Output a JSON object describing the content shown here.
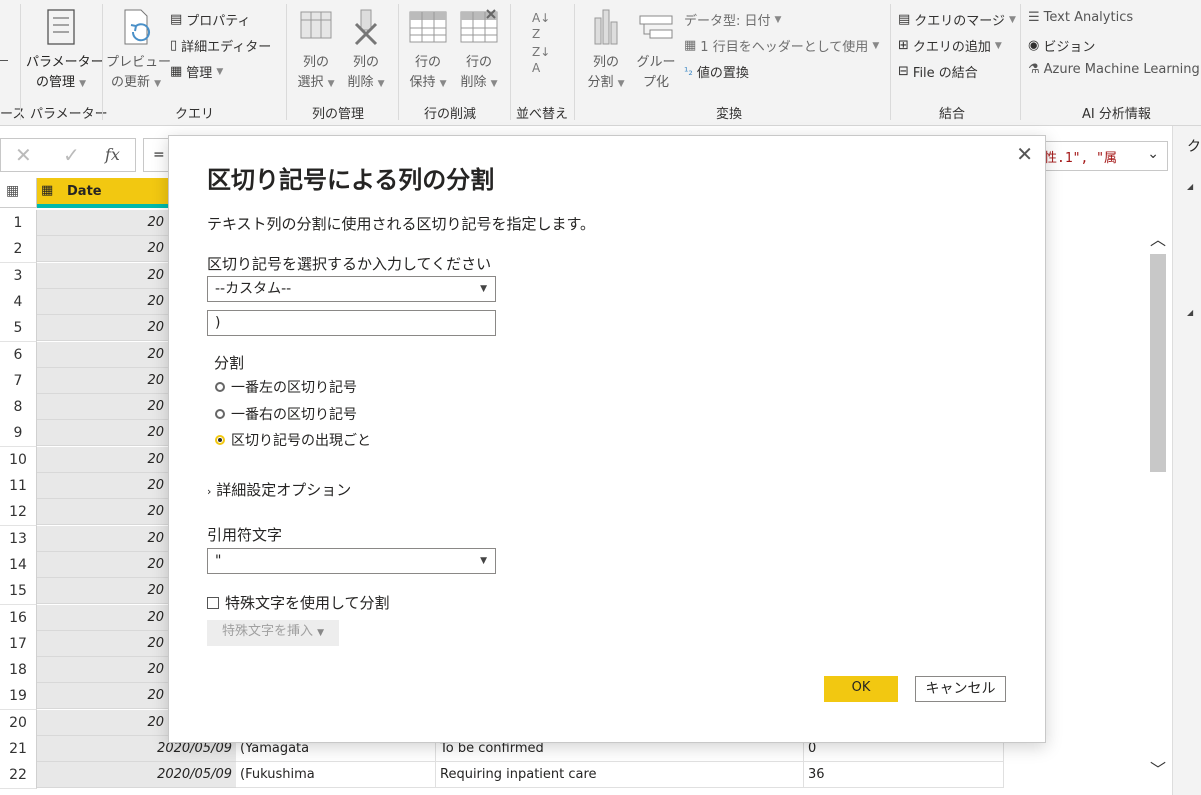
{
  "ribbon": {
    "groups": [
      {
        "label": "ース"
      },
      {
        "label": "パラメーター"
      },
      {
        "label": "クエリ"
      },
      {
        "label": "列の管理"
      },
      {
        "label": "行の削減"
      },
      {
        "label": "並べ替え"
      },
      {
        "label": "変換"
      },
      {
        "label": "結合"
      },
      {
        "label": "AI 分析情報"
      }
    ],
    "param_manage": {
      "line1": "パラメーター",
      "line2": "の管理"
    },
    "preview_refresh": {
      "line1": "プレビュー",
      "line2": "の更新"
    },
    "properties": "プロパティ",
    "advanced_editor": "詳細エディター",
    "manage": "管理",
    "choose_columns": {
      "line1": "列の",
      "line2": "選択"
    },
    "remove_columns": {
      "line1": "列の",
      "line2": "削除"
    },
    "keep_rows": {
      "line1": "行の",
      "line2": "保持"
    },
    "remove_rows": {
      "line1": "行の",
      "line2": "削除"
    },
    "split_column": {
      "line1": "列の",
      "line2": "分割"
    },
    "group_by": {
      "line1": "グルー",
      "line2": "プ化"
    },
    "data_type": "データ型: 日付",
    "use_first_row": "1 行目をヘッダーとして使用",
    "replace_values": "値の置換",
    "merge_queries": "クエリのマージ",
    "append_queries": "クエリの追加",
    "combine_files": "File の結合",
    "text_analytics": "Text Analytics",
    "vision": "ビジョン",
    "azure_ml": "Azure Machine Learning"
  },
  "formula_bar": {
    "fx": "fx",
    "equals": "=",
    "right_text": "性.1\", \"属"
  },
  "grid": {
    "header_date": "Date",
    "row_numbers": [
      "1",
      "2",
      "3",
      "4",
      "5",
      "6",
      "7",
      "8",
      "9",
      "10",
      "11",
      "12",
      "13",
      "14",
      "15",
      "16",
      "17",
      "18",
      "19",
      "20",
      "21",
      "22"
    ],
    "date_partial": "20",
    "row21": {
      "date": "2020/05/09",
      "pref": "(Yamagata",
      "status": "To be confirmed",
      "value": "0"
    },
    "row22": {
      "date": "2020/05/09",
      "pref": "(Fukushima",
      "status": "Requiring inpatient care",
      "value": "36"
    }
  },
  "dialog": {
    "title": "区切り記号による列の分割",
    "description": "テキスト列の分割に使用される区切り記号を指定します。",
    "delimiter_label": "区切り記号を選択するか入力してください",
    "delimiter_select": "--カスタム--",
    "custom_delimiter_value": ")",
    "split_label": "分割",
    "radio_leftmost": "一番左の区切り記号",
    "radio_rightmost": "一番右の区切り記号",
    "radio_each": "区切り記号の出現ごと",
    "advanced_options": "詳細設定オプション",
    "quote_label": "引用符文字",
    "quote_select": "\"",
    "special_chars_checkbox": "特殊文字を使用して分割",
    "insert_special_char": "特殊文字を挿入",
    "ok": "OK",
    "cancel": "キャンセル"
  },
  "right_panel": {
    "partial_char": "ク"
  },
  "colors": {
    "accent_yellow": "#f2c811",
    "header_teal": "#01b8aa"
  }
}
